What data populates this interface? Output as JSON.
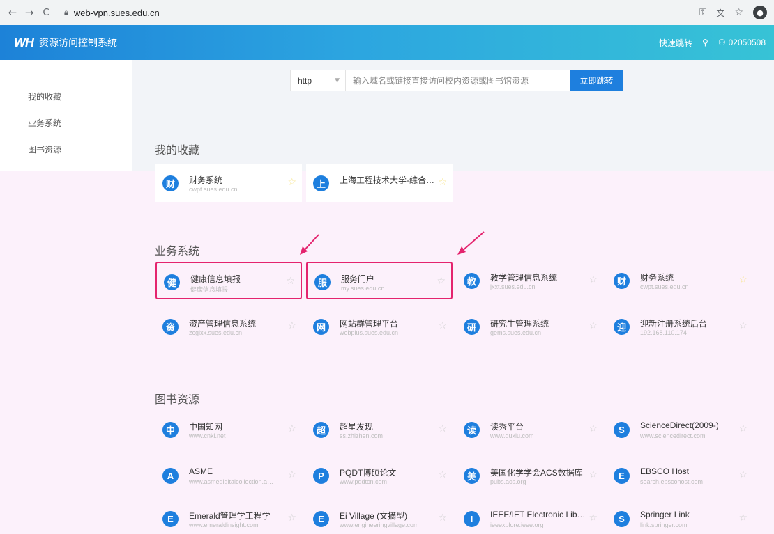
{
  "browser": {
    "back": "←",
    "forward": "→",
    "reload": "C",
    "url": "web-vpn.sues.edu.cn",
    "key_icon": "key-icon",
    "translate_icon": "translate-icon",
    "star_icon": "star-icon",
    "profile_icon": "account-icon"
  },
  "header": {
    "logo": "WH",
    "title": "资源访问控制系统",
    "quick_jump": "快速跳转",
    "user_id": "02050508"
  },
  "sidebar": {
    "items": [
      {
        "label": "我的收藏"
      },
      {
        "label": "业务系统"
      },
      {
        "label": "图书资源"
      }
    ]
  },
  "search": {
    "protocol": "http",
    "placeholder": "输入域名或链接直接访问校内资源或图书馆资源",
    "button": "立即跳转"
  },
  "sections": {
    "favorites": {
      "title": "我的收藏",
      "cards": [
        {
          "icon": "财",
          "name": "财务系统",
          "url": "cwpt.sues.edu.cn",
          "starred": true
        },
        {
          "icon": "上",
          "name": "上海工程技术大学-综合…",
          "url": "",
          "starred": true
        }
      ]
    },
    "business": {
      "title": "业务系统",
      "cards": [
        {
          "icon": "健",
          "name": "健康信息填报",
          "url": "健康信息填报",
          "starred": false,
          "highlight": true
        },
        {
          "icon": "服",
          "name": "服务门户",
          "url": "my.sues.edu.cn",
          "starred": false,
          "highlight": true
        },
        {
          "icon": "教",
          "name": "教学管理信息系统",
          "url": "jxxt.sues.edu.cn",
          "starred": false
        },
        {
          "icon": "财",
          "name": "财务系统",
          "url": "cwpt.sues.edu.cn",
          "starred": true
        },
        {
          "icon": "资",
          "name": "资产管理信息系统",
          "url": "zcglxx.sues.edu.cn",
          "starred": false
        },
        {
          "icon": "网",
          "name": "网站群管理平台",
          "url": "webplus.sues.edu.cn",
          "starred": false
        },
        {
          "icon": "研",
          "name": "研究生管理系统",
          "url": "gems.sues.edu.cn",
          "starred": false
        },
        {
          "icon": "迎",
          "name": "迎新注册系统后台",
          "url": "192.168.110.174",
          "starred": false
        }
      ]
    },
    "library": {
      "title": "图书资源",
      "cards": [
        {
          "icon": "中",
          "name": "中国知网",
          "url": "www.cnki.net",
          "starred": false
        },
        {
          "icon": "超",
          "name": "超星发现",
          "url": "ss.zhizhen.com",
          "starred": false
        },
        {
          "icon": "读",
          "name": "读秀平台",
          "url": "www.duxiu.com",
          "starred": false
        },
        {
          "icon": "S",
          "name": "ScienceDirect(2009-)",
          "url": "www.sciencedirect.com",
          "starred": false
        },
        {
          "icon": "A",
          "name": "ASME",
          "url": "www.asmedigitalcollection.a…",
          "starred": false
        },
        {
          "icon": "P",
          "name": "PQDT博硕论文",
          "url": "www.pqdtcn.com",
          "starred": false
        },
        {
          "icon": "美",
          "name": "美国化学学会ACS数据库",
          "url": "pubs.acs.org",
          "starred": false
        },
        {
          "icon": "E",
          "name": "EBSCO Host",
          "url": "search.ebscohost.com",
          "starred": false
        },
        {
          "icon": "E",
          "name": "Emerald管理学工程学",
          "url": "www.emeraldinsight.com",
          "starred": false
        },
        {
          "icon": "E",
          "name": "Ei Village (文摘型)",
          "url": "www.engineeringvillage.com",
          "starred": false
        },
        {
          "icon": "I",
          "name": "IEEE/IET Electronic Lib…",
          "url": "ieeexplore.ieee.org",
          "starred": false
        },
        {
          "icon": "S",
          "name": "Springer Link",
          "url": "link.springer.com",
          "starred": false
        }
      ]
    }
  },
  "colors": {
    "accent": "#1e7fde",
    "highlight_border": "#e4246e",
    "page_background": "#fcf1fb",
    "star_active": "#f7e48a"
  }
}
